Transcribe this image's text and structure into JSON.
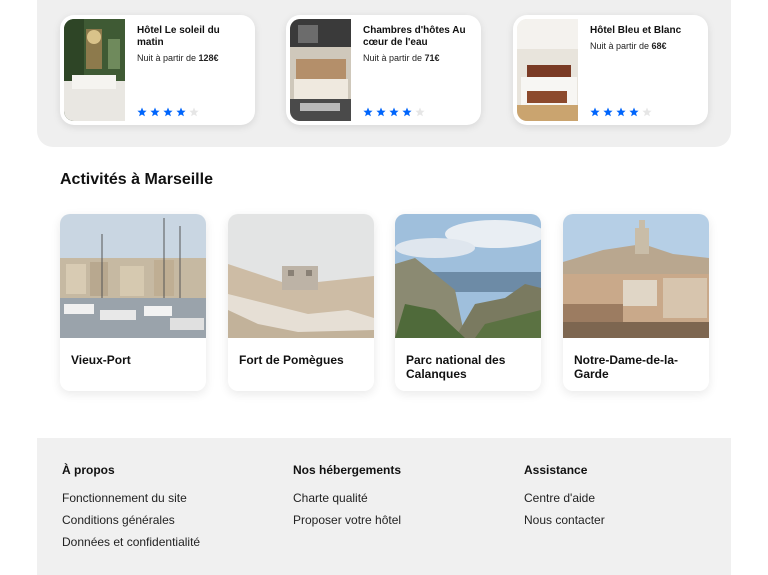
{
  "hotels": [
    {
      "name": "Hôtel Le soleil du matin",
      "price_prefix": "Nuit à partir de ",
      "price": "128€",
      "rating": 4
    },
    {
      "name": "Chambres d'hôtes Au cœur de l'eau",
      "price_prefix": "Nuit à partir de ",
      "price": "71€",
      "rating": 4
    },
    {
      "name": "Hôtel Bleu et Blanc",
      "price_prefix": "Nuit à partir de ",
      "price": "68€",
      "rating": 4
    }
  ],
  "activities": {
    "title": "Activités à Marseille",
    "items": [
      {
        "label": "Vieux-Port"
      },
      {
        "label": "Fort de Pomègues"
      },
      {
        "label": "Parc national des Calanques"
      },
      {
        "label": "Notre-Dame-de-la-Garde"
      }
    ]
  },
  "footer": {
    "columns": [
      {
        "heading": "À propos",
        "links": [
          "Fonctionnement du site",
          "Conditions générales",
          "Données et confidentialité"
        ]
      },
      {
        "heading": "Nos hébergements",
        "links": [
          "Charte qualité",
          "Proposer votre hôtel"
        ]
      },
      {
        "heading": "Assistance",
        "links": [
          "Centre d'aide",
          "Nous contacter"
        ]
      }
    ]
  },
  "colors": {
    "star_filled": "#0065fc",
    "star_empty": "#e6e6e6",
    "band_bg": "#efefef",
    "footer_bg": "#f0f0f0"
  }
}
